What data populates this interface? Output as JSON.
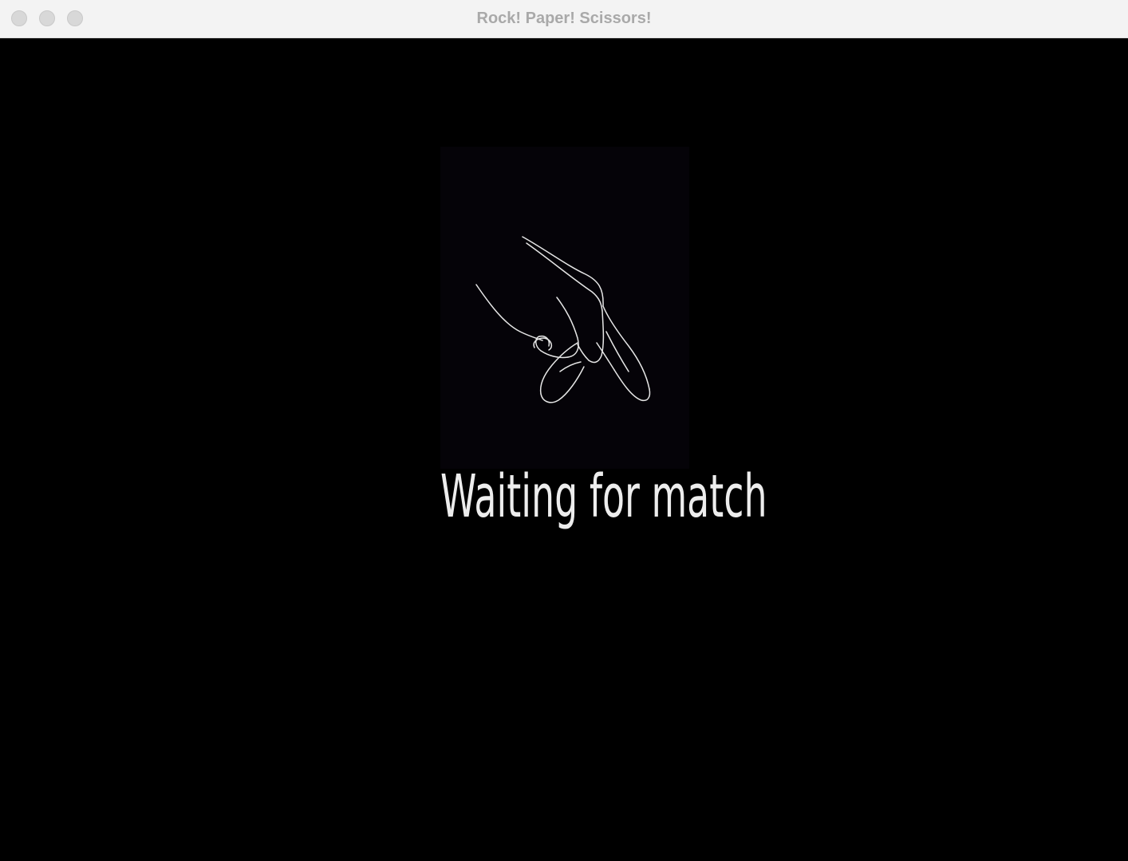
{
  "window": {
    "title": "Rock! Paper! Scissors!"
  },
  "main": {
    "status_text": "Waiting for match",
    "illustration_icon": "hand-pointing-down-icon"
  },
  "colors": {
    "background": "#000000",
    "titlebar": "#f3f3f3",
    "title_text": "#a9a9a9",
    "status_text": "#ededed",
    "line_art": "#e6e6e6"
  }
}
